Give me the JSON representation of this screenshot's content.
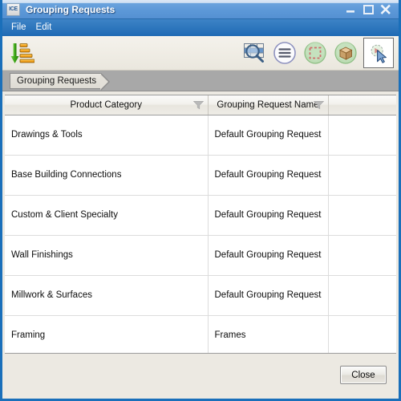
{
  "window": {
    "title": "Grouping Requests",
    "app_icon_label": "ICE",
    "accent_color": "#1a6fba",
    "controls": {
      "minimize": "minimize-button",
      "maximize": "maximize-button",
      "close": "close-button"
    }
  },
  "menubar": {
    "items": [
      {
        "label": "File"
      },
      {
        "label": "Edit"
      }
    ]
  },
  "toolbar": {
    "left_items": [
      {
        "name": "sort-descending-icon",
        "tooltip": "Sort Descending"
      }
    ],
    "right_items": [
      {
        "name": "find-in-table-icon",
        "tooltip": "Find"
      },
      {
        "name": "list-menu-icon",
        "tooltip": "List Options"
      },
      {
        "name": "select-region-icon",
        "tooltip": "Select Region"
      },
      {
        "name": "model-box-icon",
        "tooltip": "3D Model"
      },
      {
        "name": "pick-cursor-icon",
        "tooltip": "Pick",
        "pressed": true
      }
    ]
  },
  "breadcrumb": {
    "crumbs": [
      {
        "label": "Grouping Requests"
      }
    ]
  },
  "table": {
    "columns": [
      {
        "label": "Product Category",
        "filter": true
      },
      {
        "label": "Grouping Request Name",
        "filter": true
      },
      {
        "label": "",
        "filter": false
      }
    ],
    "rows": [
      {
        "product_category": "Drawings & Tools",
        "grouping_request_name": "Default Grouping Request"
      },
      {
        "product_category": "Base Building Connections",
        "grouping_request_name": "Default Grouping Request"
      },
      {
        "product_category": "Custom & Client Specialty",
        "grouping_request_name": "Default Grouping Request"
      },
      {
        "product_category": "Wall Finishings",
        "grouping_request_name": "Default Grouping Request"
      },
      {
        "product_category": "Millwork & Surfaces",
        "grouping_request_name": "Default Grouping Request"
      },
      {
        "product_category": "Framing",
        "grouping_request_name": "Frames"
      }
    ]
  },
  "footer": {
    "close_label": "Close"
  }
}
